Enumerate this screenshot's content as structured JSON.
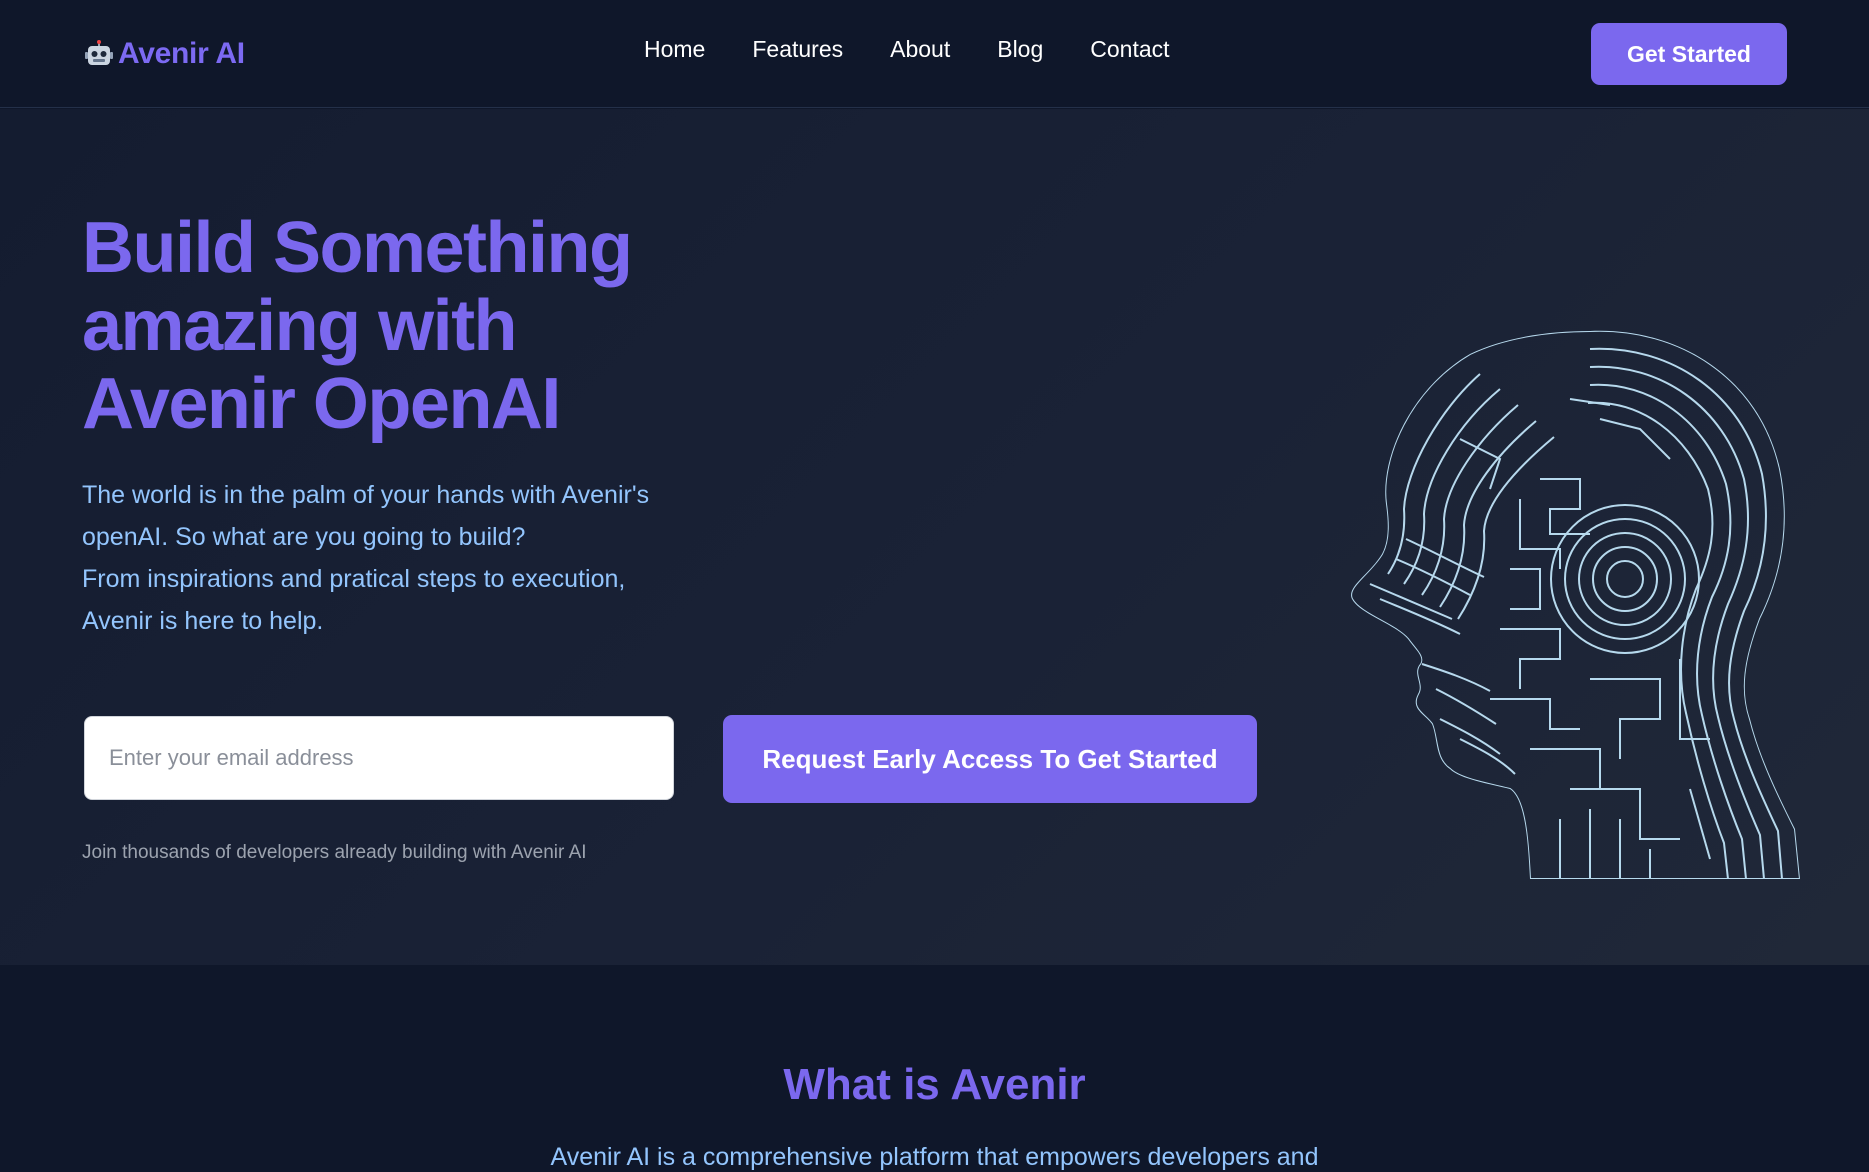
{
  "nav": {
    "brand_icon": "robot-icon",
    "brand": "Avenir AI",
    "links": [
      "Home",
      "Features",
      "About",
      "Blog",
      "Contact"
    ],
    "cta": "Get Started"
  },
  "hero": {
    "title_lines": [
      "Build Something",
      "amazing with",
      "Avenir OpenAI"
    ],
    "description_lines": [
      "The world is in the palm of your hands with Avenir's",
      "openAI. So what are you going to build?",
      "From inspirations and pratical steps to execution,",
      "Avenir is here to help."
    ],
    "email_placeholder": "Enter your email address",
    "email_value": "",
    "cta": "Request Early Access To Get Started",
    "note": "Join thousands of developers already building with Avenir AI",
    "image": "wireframe-head-illustration"
  },
  "about": {
    "title": "What is Avenir",
    "description": "Avenir AI is a comprehensive platform that empowers developers and"
  },
  "colors": {
    "background": "#0f172a",
    "hero_background": "#1a2236",
    "accent": "#7b68ee",
    "text_light_blue": "#93c5fd",
    "muted": "#9ca3af",
    "head_lines": "#bfe3f7"
  }
}
